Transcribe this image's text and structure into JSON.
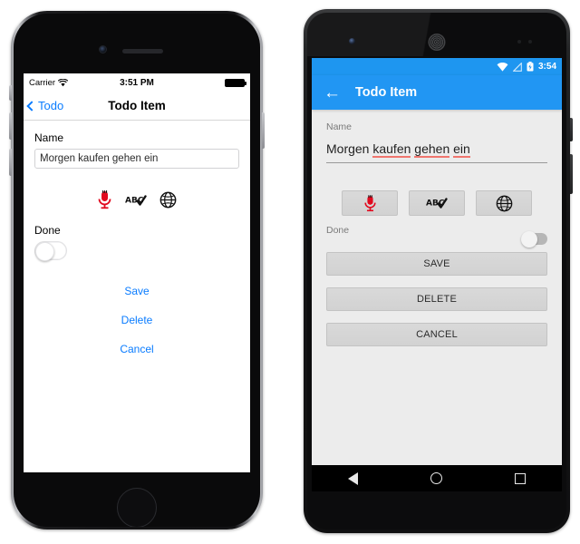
{
  "page": {
    "background": "#ffffff"
  },
  "ios": {
    "status": {
      "carrier": "Carrier",
      "wifi_icon": "wifi-icon",
      "time": "3:51 PM",
      "battery_icon": "battery-icon"
    },
    "nav": {
      "back_label": "Todo",
      "back_icon": "chevron-left-icon",
      "title": "Todo Item"
    },
    "form": {
      "name_label": "Name",
      "name_value": "Morgen kaufen gehen ein",
      "name_placeholder": "Name",
      "done_label": "Done",
      "done_on": false
    },
    "icons": [
      {
        "name": "microphone-icon",
        "color": "#e1091e"
      },
      {
        "name": "abc-spellcheck-icon",
        "color": "#111111"
      },
      {
        "name": "globe-icon",
        "color": "#111111"
      }
    ],
    "actions": [
      {
        "label": "Save",
        "name": "save-button"
      },
      {
        "label": "Delete",
        "name": "delete-button"
      },
      {
        "label": "Cancel",
        "name": "cancel-button"
      }
    ],
    "accent": "#0a7cff"
  },
  "android": {
    "status": {
      "wifi_icon": "wifi-icon",
      "signal_icon": "signal-icon",
      "battery_icon": "battery-charging-icon",
      "time": "3:54"
    },
    "appbar": {
      "back_icon": "arrow-left-icon",
      "title": "Todo Item",
      "color": "#2196f3"
    },
    "form": {
      "name_label": "Name",
      "name_words": [
        "Morgen ",
        "kaufen",
        " ",
        "gehen",
        " ",
        "ein"
      ],
      "name_value": "Morgen kaufen gehen ein",
      "misspelled": [
        "kaufen",
        "gehen",
        "ein"
      ],
      "done_label": "Done",
      "done_on": false
    },
    "icons": [
      {
        "name": "microphone-icon",
        "color": "#e1091e"
      },
      {
        "name": "abc-spellcheck-icon",
        "color": "#111111"
      },
      {
        "name": "globe-icon",
        "color": "#111111"
      }
    ],
    "buttons": [
      {
        "label": "SAVE",
        "name": "save-button"
      },
      {
        "label": "DELETE",
        "name": "delete-button"
      },
      {
        "label": "CANCEL",
        "name": "cancel-button"
      }
    ],
    "navbar": [
      {
        "name": "nav-back-button",
        "icon": "triangle-left-icon"
      },
      {
        "name": "nav-home-button",
        "icon": "circle-icon"
      },
      {
        "name": "nav-recents-button",
        "icon": "square-icon"
      }
    ]
  }
}
